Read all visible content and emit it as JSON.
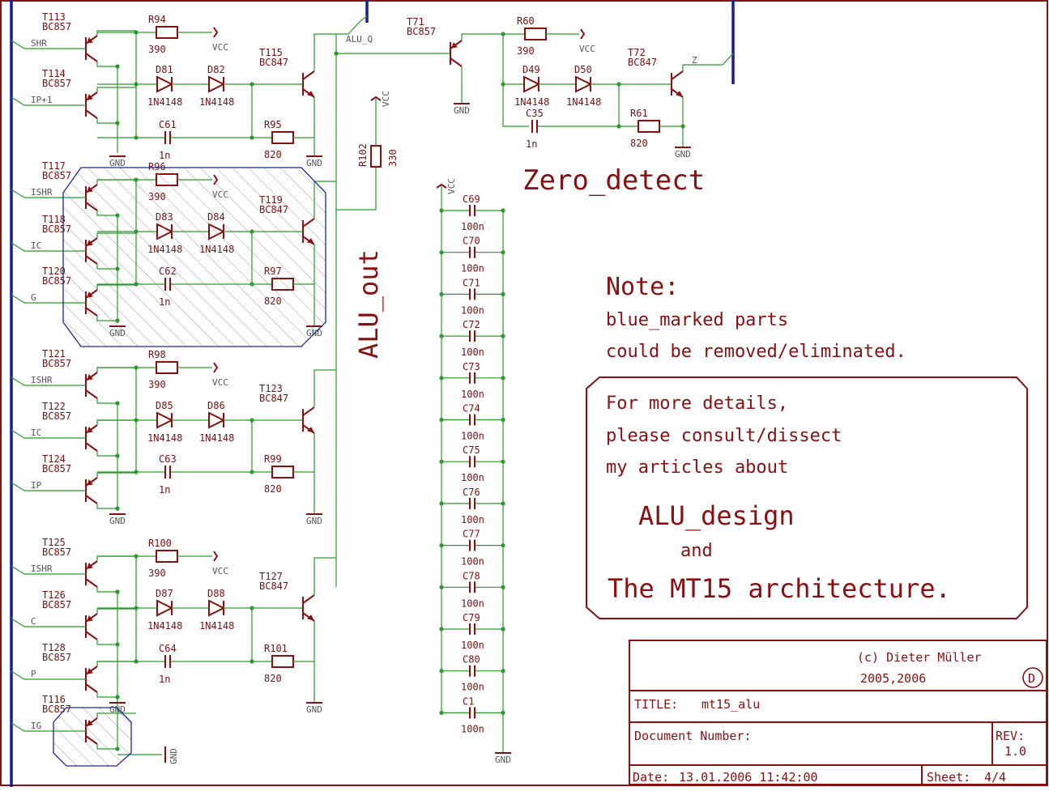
{
  "sheet_text": {
    "zero_detect": "Zero_detect",
    "alu_out": "ALU_out",
    "alu_q": "ALU_Q",
    "z_label": "Z",
    "note_title": "Note:",
    "note_line1": "blue_marked parts",
    "note_line2": "could be removed/eliminated.",
    "box_line1": "For more details,",
    "box_line2": "please consult/dissect",
    "box_line3": "my articles about",
    "box_line4": "ALU_design",
    "box_line5": "and",
    "box_line6": "The MT15 architecture."
  },
  "title_block": {
    "copyright": "(c) Dieter Müller",
    "years": "2005,2006",
    "logo_letter": "D",
    "title_label": "TITLE:",
    "title_value": "mt15_alu",
    "docnum_label": "Document Number:",
    "rev_label": "REV:",
    "rev_value": "1.0",
    "date_label": "Date:",
    "date_value": "13.01.2006 11:42:00",
    "sheet_label": "Sheet:",
    "sheet_value": "4/4"
  },
  "ladder_pairs": [
    {
      "ref": "C69",
      "val": "100n"
    },
    {
      "ref": "C70",
      "val": "100n"
    },
    {
      "ref": "C71",
      "val": "100n"
    },
    {
      "ref": "C72",
      "val": "100n"
    },
    {
      "ref": "C73",
      "val": "100n"
    },
    {
      "ref": "C74",
      "val": "100n"
    },
    {
      "ref": "C75",
      "val": "100n"
    },
    {
      "ref": "C76",
      "val": "100n"
    },
    {
      "ref": "C77",
      "val": "100n"
    },
    {
      "ref": "C78",
      "val": "100n"
    },
    {
      "ref": "C79",
      "val": "100n"
    },
    {
      "ref": "C80",
      "val": "100n"
    },
    {
      "ref": "C1",
      "val": "100n"
    }
  ],
  "ladder": {
    "vcc": "VCC",
    "gnd": "GND"
  },
  "blocks": [
    {
      "nets": [
        "SHR",
        "IP+1"
      ],
      "pnp": [
        {
          "ref": "T113",
          "type": "BC857"
        },
        {
          "ref": "T114",
          "type": "BC857"
        }
      ],
      "res_pullup": {
        "ref": "R94",
        "val": "390"
      },
      "diodes": [
        {
          "ref": "D81",
          "val": "1N4148"
        },
        {
          "ref": "D82",
          "val": "1N4148"
        }
      ],
      "cap": {
        "ref": "C61",
        "val": "1n"
      },
      "res_base": {
        "ref": "R95",
        "val": "820"
      },
      "npn": {
        "ref": "T115",
        "type": "BC847"
      },
      "vcc": "VCC",
      "gnd": "GND"
    },
    {
      "nets": [
        "ISHR",
        "IC",
        "G"
      ],
      "pnp": [
        {
          "ref": "T117",
          "type": "BC857"
        },
        {
          "ref": "T118",
          "type": "BC857"
        },
        {
          "ref": "T120",
          "type": "BC857"
        }
      ],
      "res_pullup": {
        "ref": "R96",
        "val": "390"
      },
      "diodes": [
        {
          "ref": "D83",
          "val": "1N4148"
        },
        {
          "ref": "D84",
          "val": "1N4148"
        }
      ],
      "cap": {
        "ref": "C62",
        "val": "1n"
      },
      "res_base": {
        "ref": "R97",
        "val": "820"
      },
      "npn": {
        "ref": "T119",
        "type": "BC847"
      },
      "vcc": "VCC",
      "gnd": "GND"
    },
    {
      "nets": [
        "ISHR",
        "IC",
        "IP"
      ],
      "pnp": [
        {
          "ref": "T121",
          "type": "BC857"
        },
        {
          "ref": "T122",
          "type": "BC857"
        },
        {
          "ref": "T124",
          "type": "BC857"
        }
      ],
      "res_pullup": {
        "ref": "R98",
        "val": "390"
      },
      "diodes": [
        {
          "ref": "D85",
          "val": "1N4148"
        },
        {
          "ref": "D86",
          "val": "1N4148"
        }
      ],
      "cap": {
        "ref": "C63",
        "val": "1n"
      },
      "res_base": {
        "ref": "R99",
        "val": "820"
      },
      "npn": {
        "ref": "T123",
        "type": "BC847"
      },
      "vcc": "VCC",
      "gnd": "GND"
    },
    {
      "nets": [
        "ISHR",
        "C",
        "P",
        "IG"
      ],
      "pnp": [
        {
          "ref": "T125",
          "type": "BC857"
        },
        {
          "ref": "T126",
          "type": "BC857"
        },
        {
          "ref": "T128",
          "type": "BC857"
        },
        {
          "ref": "T116",
          "type": "BC857"
        }
      ],
      "res_pullup": {
        "ref": "R100",
        "val": "390"
      },
      "diodes": [
        {
          "ref": "D87",
          "val": "1N4148"
        },
        {
          "ref": "D88",
          "val": "1N4148"
        }
      ],
      "cap": {
        "ref": "C64",
        "val": "1n"
      },
      "res_base": {
        "ref": "R101",
        "val": "820"
      },
      "npn": {
        "ref": "T127",
        "type": "BC847"
      },
      "vcc": "VCC",
      "gnd": "GND"
    }
  ],
  "zero_block": {
    "pnp": {
      "ref": "T71",
      "type": "BC857"
    },
    "res_pullup": {
      "ref": "R60",
      "val": "390"
    },
    "diodes": [
      {
        "ref": "D49",
        "val": "1N4148"
      },
      {
        "ref": "D50",
        "val": "1N4148"
      }
    ],
    "cap": {
      "ref": "C35",
      "val": "1n"
    },
    "res_base": {
      "ref": "R61",
      "val": "820"
    },
    "npn": {
      "ref": "T72",
      "type": "BC847"
    },
    "vcc": "VCC",
    "gnd": "GND"
  },
  "r102": {
    "ref": "R102",
    "val": "330",
    "vcc": "VCC"
  }
}
